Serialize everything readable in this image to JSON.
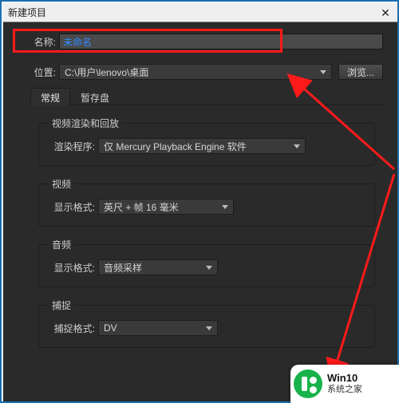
{
  "window": {
    "title": "新建项目",
    "close_glyph": "✕"
  },
  "name_row": {
    "label": "名称:",
    "value": "未命名"
  },
  "location_row": {
    "label": "位置:",
    "path": "C:\\用户\\lenovo\\桌面",
    "browse_label": "浏览..."
  },
  "tabs": {
    "general": "常规",
    "scratch": "暂存盘"
  },
  "groups": {
    "render": {
      "legend": "视频渲染和回放",
      "renderer_label": "渲染程序:",
      "renderer_value": "仅 Mercury Playback Engine 软件"
    },
    "video": {
      "legend": "视频",
      "display_label": "显示格式:",
      "display_value": "英尺 + 帧 16 毫米"
    },
    "audio": {
      "legend": "音频",
      "display_label": "显示格式:",
      "display_value": "音频采样"
    },
    "capture": {
      "legend": "捕捉",
      "capture_label": "捕捉格式:",
      "capture_value": "DV"
    }
  },
  "badge": {
    "line1": "Win10",
    "line2": "系统之家"
  }
}
